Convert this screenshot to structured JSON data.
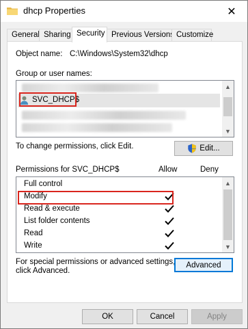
{
  "window": {
    "title": "dhcp Properties",
    "close_glyph": "✕"
  },
  "tabs": [
    {
      "label": "General"
    },
    {
      "label": "Sharing"
    },
    {
      "label": "Security"
    },
    {
      "label": "Previous Versions"
    },
    {
      "label": "Customize"
    }
  ],
  "security": {
    "object_name_label": "Object name:",
    "object_name_value": "C:\\Windows\\System32\\dhcp",
    "groups_label": "Group or user names:",
    "groups": [
      {
        "name": "SVC_DHCP$",
        "icon": "user-icon",
        "selected": true
      }
    ],
    "change_perm_text": "To change permissions, click Edit.",
    "edit_button": "Edit...",
    "permissions_for_label": "Permissions for SVC_DHCP$",
    "allow_header": "Allow",
    "deny_header": "Deny",
    "permissions": [
      {
        "name": "Full control",
        "allow": false,
        "deny": false
      },
      {
        "name": "Modify",
        "allow": true,
        "deny": false
      },
      {
        "name": "Read & execute",
        "allow": true,
        "deny": false
      },
      {
        "name": "List folder contents",
        "allow": true,
        "deny": false
      },
      {
        "name": "Read",
        "allow": true,
        "deny": false
      },
      {
        "name": "Write",
        "allow": true,
        "deny": false
      }
    ],
    "advanced_text": "For special permissions or advanced settings, click Advanced.",
    "advanced_line1": "For special permissions or advanced settings,",
    "advanced_line2": "click Advanced.",
    "advanced_button": "Advanced"
  },
  "footer": {
    "ok": "OK",
    "cancel": "Cancel",
    "apply": "Apply"
  },
  "colors": {
    "highlight": "#d9251d",
    "accent": "#0078d7"
  }
}
